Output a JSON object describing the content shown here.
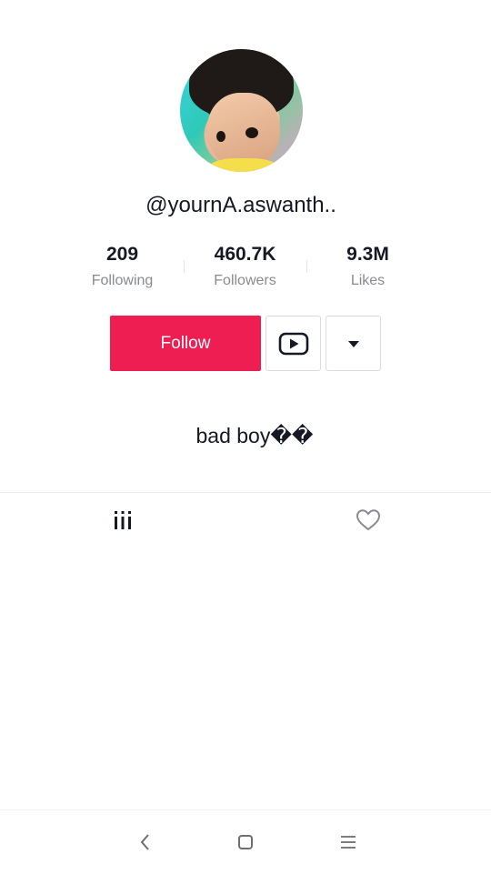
{
  "profile": {
    "username": "@yournA.aswanth..",
    "bio": "bad boy��"
  },
  "stats": [
    {
      "value": "209",
      "label": "Following"
    },
    {
      "value": "460.7K",
      "label": "Followers"
    },
    {
      "value": "9.3M",
      "label": "Likes"
    }
  ],
  "actions": {
    "follow_label": "Follow"
  },
  "colors": {
    "accent": "#ee1d52",
    "text": "#161823",
    "muted": "#8a8b91"
  },
  "icons": {
    "youtube": "youtube-icon",
    "dropdown": "caret-down-icon",
    "videos_tab": "grid-bars-icon",
    "liked_tab": "heart-outline-icon",
    "nav_back": "back-chevron-icon",
    "nav_home": "home-square-icon",
    "nav_menu": "menu-lines-icon"
  }
}
